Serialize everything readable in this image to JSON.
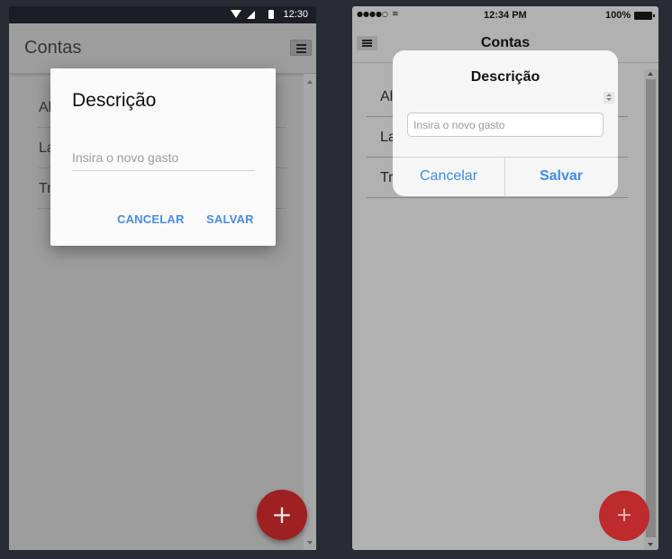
{
  "android": {
    "status_bar": {
      "time": "12:30",
      "icons": [
        "wifi-icon",
        "signal-icon",
        "battery-icon"
      ]
    },
    "app_bar": {
      "title": "Contas",
      "menu_icon": "hamburger-menu-icon"
    },
    "list_items": [
      {
        "label": "Al"
      },
      {
        "label": "La"
      },
      {
        "label": "Tr"
      }
    ],
    "dialog": {
      "title": "Descrição",
      "input_placeholder": "Insira o novo gasto",
      "input_value": "",
      "cancel_label": "CANCELAR",
      "save_label": "SALVAR"
    },
    "fab": {
      "label": "+",
      "icon": "plus-icon",
      "color": "#9e2022"
    },
    "colors": {
      "accent": "#4a8ce2",
      "status_bar": "#1b1e24",
      "dialog_bg": "#fafafa"
    }
  },
  "ios": {
    "status_bar": {
      "signal_dots": "●●●●○",
      "wifi": "wifi-icon",
      "time": "12:34 PM",
      "battery_percent": "100%"
    },
    "nav_bar": {
      "title": "Contas",
      "menu_icon": "hamburger-menu-icon"
    },
    "list_items": [
      {
        "label": "Al"
      },
      {
        "label": "La"
      },
      {
        "label": "Tr"
      }
    ],
    "dialog": {
      "title": "Descrição",
      "input_placeholder": "Insira o novo gasto",
      "input_value": "",
      "cancel_label": "Cancelar",
      "save_label": "Salvar"
    },
    "fab": {
      "label": "+",
      "icon": "plus-icon",
      "color": "#bd2b2d"
    },
    "colors": {
      "accent": "#3f8de4",
      "dialog_bg": "#f6f6f6"
    }
  }
}
